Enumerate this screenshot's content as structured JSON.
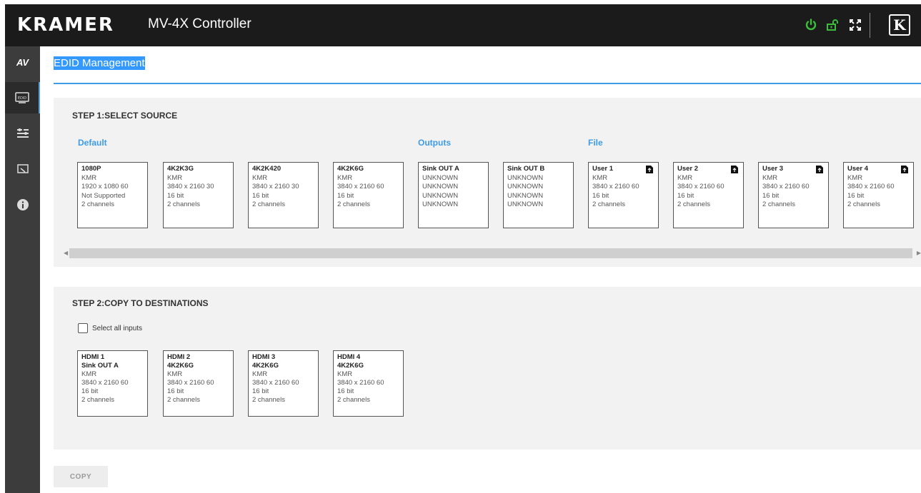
{
  "header": {
    "logo": "KRAMER",
    "app_title": "MV-4X Controller",
    "icons": [
      "power-icon",
      "unlock-icon",
      "fullscreen-icon",
      "kramer-k-icon"
    ],
    "kramer_badge": "K",
    "accent_color": "#3bbf3b"
  },
  "sidebar": {
    "items": [
      {
        "label": "AV",
        "icon": "av-icon"
      },
      {
        "label": "EDID",
        "icon": "edid-icon"
      },
      {
        "label": "",
        "icon": "settings-sliders-icon"
      },
      {
        "label": "",
        "icon": "display-icon"
      },
      {
        "label": "",
        "icon": "info-icon"
      }
    ]
  },
  "page": {
    "title": "EDID Management",
    "accent_color": "#3e9be6"
  },
  "step1": {
    "title": "STEP 1:SELECT SOURCE",
    "groups": {
      "default": "Default",
      "outputs": "Outputs",
      "file": "File"
    },
    "cards": [
      {
        "name": "1080P",
        "l1": "KMR",
        "l2": "1920 x 1080 60",
        "l3": "Not Supported",
        "l4": "2 channels"
      },
      {
        "name": "4K2K3G",
        "l1": "KMR",
        "l2": "3840 x 2160 30",
        "l3": "16 bit",
        "l4": "2 channels"
      },
      {
        "name": "4K2K420",
        "l1": "KMR",
        "l2": "3840 x 2160 30",
        "l3": "16 bit",
        "l4": "2 channels"
      },
      {
        "name": "4K2K6G",
        "l1": "KMR",
        "l2": "3840 x 2160 60",
        "l3": "16 bit",
        "l4": "2 channels"
      },
      {
        "name": "Sink OUT A",
        "l1": "UNKNOWN",
        "l2": "UNKNOWN",
        "l3": "UNKNOWN",
        "l4": "UNKNOWN"
      },
      {
        "name": "Sink OUT B",
        "l1": "UNKNOWN",
        "l2": "UNKNOWN",
        "l3": "UNKNOWN",
        "l4": "UNKNOWN"
      },
      {
        "name": "User 1",
        "l1": "KMR",
        "l2": "3840 x 2160 60",
        "l3": "16 bit",
        "l4": "2 channels"
      },
      {
        "name": "User 2",
        "l1": "KMR",
        "l2": "3840 x 2160 60",
        "l3": "16 bit",
        "l4": "2 channels"
      },
      {
        "name": "User 3",
        "l1": "KMR",
        "l2": "3840 x 2160 60",
        "l3": "16 bit",
        "l4": "2 channels"
      },
      {
        "name": "User 4",
        "l1": "KMR",
        "l2": "3840 x 2160 60",
        "l3": "16 bit",
        "l4": "2 channels"
      }
    ]
  },
  "step2": {
    "title": "STEP 2:COPY TO DESTINATIONS",
    "select_all_label": "Select all inputs",
    "cards": [
      {
        "input": "HDMI 1",
        "edid": "Sink OUT A",
        "l1": "KMR",
        "l2": "3840 x 2160 60",
        "l3": "16 bit",
        "l4": "2 channels"
      },
      {
        "input": "HDMI 2",
        "edid": "4K2K6G",
        "l1": "KMR",
        "l2": "3840 x 2160 60",
        "l3": "16 bit",
        "l4": "2 channels"
      },
      {
        "input": "HDMI 3",
        "edid": "4K2K6G",
        "l1": "KMR",
        "l2": "3840 x 2160 60",
        "l3": "16 bit",
        "l4": "2 channels"
      },
      {
        "input": "HDMI 4",
        "edid": "4K2K6G",
        "l1": "KMR",
        "l2": "3840 x 2160 60",
        "l3": "16 bit",
        "l4": "2 channels"
      }
    ]
  },
  "copy_button": "COPY"
}
